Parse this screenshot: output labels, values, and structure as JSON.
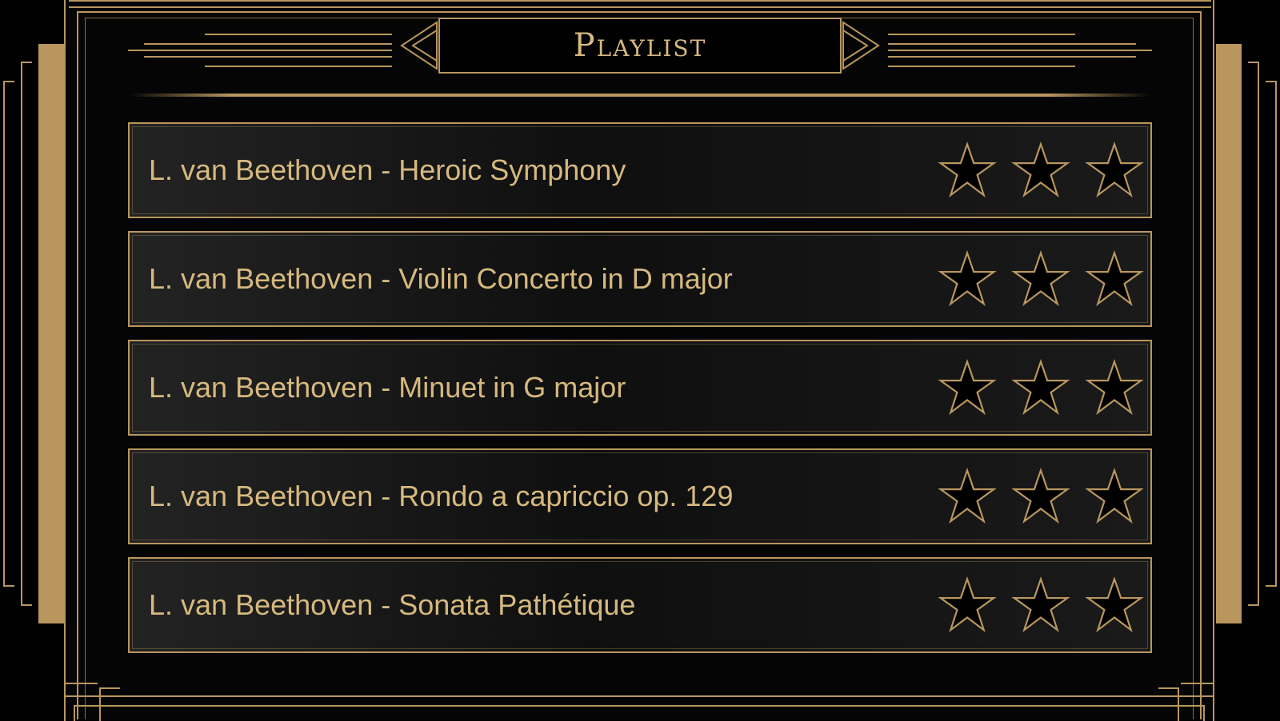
{
  "header": {
    "title": "Playlist"
  },
  "tracks": [
    {
      "title": "L. van Beethoven - Heroic Symphony",
      "rating": 0,
      "max_rating": 3
    },
    {
      "title": "L. van Beethoven - Violin Concerto in D major",
      "rating": 0,
      "max_rating": 3
    },
    {
      "title": "L. van Beethoven - Minuet in G major",
      "rating": 0,
      "max_rating": 3
    },
    {
      "title": "L. van Beethoven - Rondo a capriccio op. 129",
      "rating": 0,
      "max_rating": 3
    },
    {
      "title": "L. van Beethoven - Sonata Pathétique",
      "rating": 0,
      "max_rating": 3
    }
  ],
  "colors": {
    "gold": "#c7a86e",
    "background": "#000000",
    "star_fill": "#000000"
  },
  "icons": {
    "rating": "star-outline-icon"
  }
}
